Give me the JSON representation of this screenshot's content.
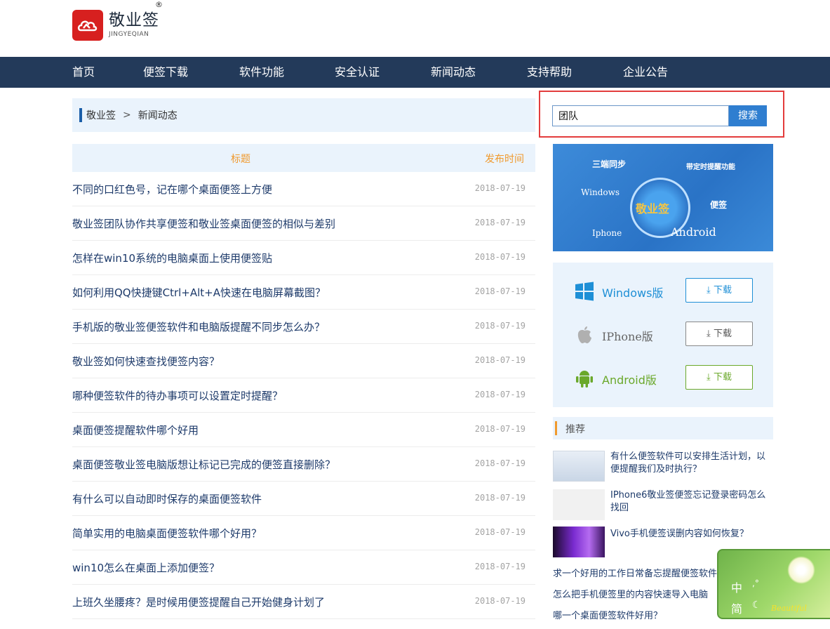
{
  "logo": {
    "name_cn": "敬业签",
    "name_en": "JINGYEQIAN",
    "reg": "®"
  },
  "nav": {
    "items": [
      "首页",
      "便签下载",
      "软件功能",
      "安全认证",
      "新闻动态",
      "支持帮助",
      "企业公告"
    ]
  },
  "breadcrumb": {
    "home": "敬业签",
    "sep": ">",
    "current": "新闻动态"
  },
  "search": {
    "value": "团队",
    "button": "搜索"
  },
  "table": {
    "col_title": "标题",
    "col_date": "发布时间",
    "rows": [
      {
        "title": "不同的口红色号，记在哪个桌面便签上方便",
        "date": "2018-07-19"
      },
      {
        "title": "敬业签团队协作共享便签和敬业签桌面便签的相似与差别",
        "date": "2018-07-19"
      },
      {
        "title": "怎样在win10系统的电脑桌面上使用便签贴",
        "date": "2018-07-19"
      },
      {
        "title": "如何利用QQ快捷键Ctrl+Alt+A快速在电脑屏幕截图？",
        "date": "2018-07-19"
      },
      {
        "title": "手机版的敬业签便签软件和电脑版提醒不同步怎么办？",
        "date": "2018-07-19"
      },
      {
        "title": "敬业签如何快速查找便签内容？",
        "date": "2018-07-19"
      },
      {
        "title": "哪种便签软件的待办事项可以设置定时提醒？",
        "date": "2018-07-19"
      },
      {
        "title": "桌面便签提醒软件哪个好用",
        "date": "2018-07-19"
      },
      {
        "title": "桌面便签敬业签电脑版想让标记已完成的便签直接删除？",
        "date": "2018-07-19"
      },
      {
        "title": "有什么可以自动即时保存的桌面便签软件",
        "date": "2018-07-19"
      },
      {
        "title": "简单实用的电脑桌面便签软件哪个好用？",
        "date": "2018-07-19"
      },
      {
        "title": "win10怎么在桌面上添加便签？",
        "date": "2018-07-19"
      },
      {
        "title": "上班久坐腰疼？是时候用便签提醒自己开始健身计划了",
        "date": "2018-07-19"
      }
    ]
  },
  "banner": {
    "t1": "三端同步",
    "t2": "带定时提醒功能",
    "t3": "Windows",
    "t4": "便签",
    "t5": "Iphone",
    "t6": "Android",
    "center": "敬业签"
  },
  "downloads": [
    {
      "name": "Windows版",
      "button": "下载",
      "icon": "windows-icon",
      "color": "#1e8fd6"
    },
    {
      "name": "IPhone版",
      "button": "下载",
      "icon": "apple-icon",
      "color": "#666666"
    },
    {
      "name": "Android版",
      "button": "下载",
      "icon": "android-icon",
      "color": "#6aa82a"
    }
  ],
  "recommend": {
    "heading": "推荐",
    "items": [
      {
        "text": "有什么便签软件可以安排生活计划，以便提醒我们及时执行？"
      },
      {
        "text": "IPhone6敬业签便签忘记登录密码怎么找回"
      },
      {
        "text": "Vivo手机便签误删内容如何恢复？"
      }
    ],
    "links": [
      "求一个好用的工作日常备忘提醒便签软件",
      "怎么把手机便签里的内容快速导入电脑",
      "哪一个桌面便签软件好用？"
    ]
  },
  "ime": {
    "k1": "中",
    "k2": ",°",
    "k3": "简",
    "k4": "☾",
    "k5": "Beautiful"
  },
  "colors": {
    "nav_bg": "#233a5a",
    "accent_blue": "#2f7ed0",
    "title_orange": "#f09a2e",
    "highlight_red": "#e33c3c"
  }
}
